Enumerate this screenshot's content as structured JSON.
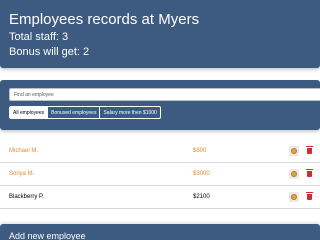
{
  "header": {
    "title": "Employees records at Myers",
    "total_staff": "Total staff: 3",
    "bonus_count": "Bonus will get: 2"
  },
  "search": {
    "placeholder": "Find an employee"
  },
  "filters": [
    {
      "label": "All employees",
      "active": true
    },
    {
      "label": "Bonused employees",
      "active": false
    },
    {
      "label": "Salary more then $1000",
      "active": false
    }
  ],
  "employees": [
    {
      "name": "Michael M.",
      "salary": "$800",
      "bonused": true,
      "cookie_icon": "cookie-icon",
      "delete_icon": "trash-icon"
    },
    {
      "name": "Sonya M.",
      "salary": "$3000",
      "bonused": true,
      "cookie_icon": "cookie-icon",
      "delete_icon": "trash-icon"
    },
    {
      "name": "Blackberry P.",
      "salary": "$2100",
      "bonused": false,
      "cookie_icon": "cookie-icon",
      "delete_icon": "trash-icon"
    }
  ],
  "add_form": {
    "title": "Add new employee"
  },
  "colors": {
    "panel": "#3d5a80",
    "bonused_text": "#e08a37",
    "delete": "#d72b2b",
    "cookie": "#e4a23a"
  }
}
